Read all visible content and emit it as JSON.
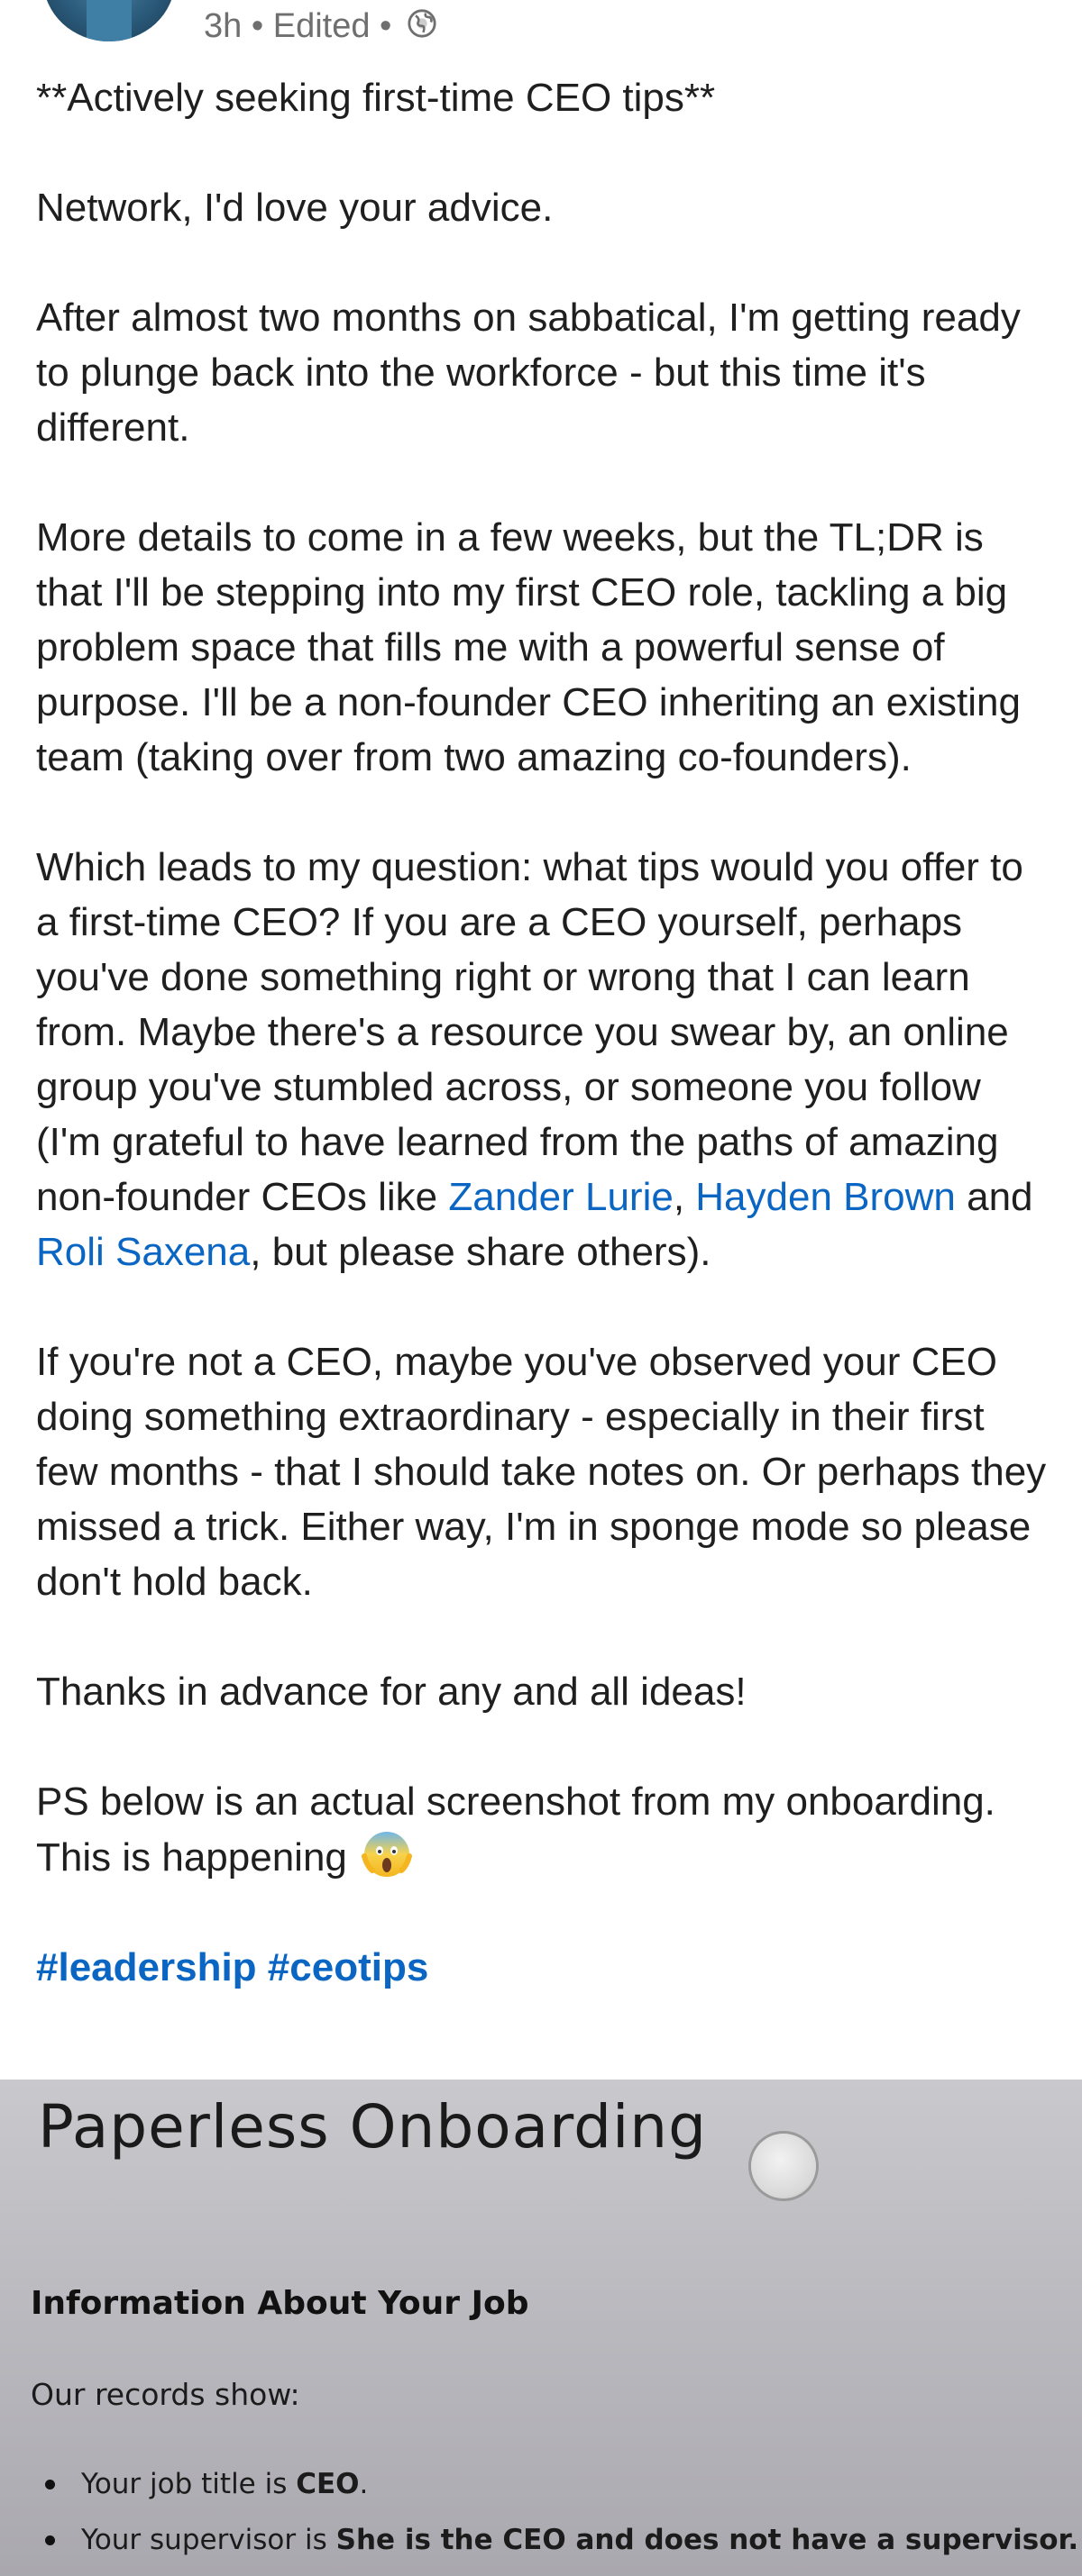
{
  "meta": {
    "time_ago": "3h",
    "separator": "•",
    "edited_label": "Edited",
    "visibility_icon": "globe-icon"
  },
  "post": {
    "paragraphs": [
      "**Actively seeking first-time CEO tips**",
      "Network, I'd love your advice.",
      "After almost two months on sabbatical, I'm getting ready to plunge back into the workforce - but this time it's different.",
      "More details to come in a few weeks, but the TL;DR is that I'll be stepping into my first CEO role, tackling a big problem space that fills me with a powerful sense of purpose. I'll be a non-founder CEO inheriting an existing team (taking over from two amazing co-founders)."
    ],
    "question": {
      "text_before": "Which leads to my question: what tips would you offer to a first-time CEO? If you are a CEO yourself, perhaps you've done something right or wrong that I can learn from. Maybe there's a resource you swear by, an online group you've stumbled across, or someone you follow (I'm grateful to have learned from the paths of amazing non-founder CEOs like ",
      "mention_1": "Zander Lurie",
      "sep_1": ", ",
      "mention_2": "Hayden Brown",
      "sep_2": " and ",
      "mention_3": "Roli Saxena",
      "text_after": ", but please share others)."
    },
    "non_ceo_paragraph": "If you're not a CEO, maybe you've observed your CEO doing something extraordinary - especially in their first few months - that I should take notes on. Or perhaps they missed a trick. Either way, I'm in sponge mode so please don't hold back.",
    "thanks_paragraph": "Thanks in advance for any and all ideas!",
    "ps_paragraph": "PS below is an actual screenshot from my onboarding. This is happening",
    "ps_emoji": "screaming-face-emoji",
    "hashtags": [
      "#leadership",
      "#ceotips"
    ]
  },
  "attached_image": {
    "title": "Paperless Onboarding",
    "heading": "Information About Your Job",
    "records_label": "Our records show:",
    "items": [
      {
        "prefix": "Your job title is ",
        "value": "CEO",
        "suffix": "."
      },
      {
        "prefix": "Your supervisor is ",
        "value": "She is the CEO and does not have a supervisor",
        "suffix": "."
      }
    ]
  },
  "colors": {
    "link": "#0a66c2",
    "meta_text": "#6f6f6f",
    "body_text": "#1f1f1f"
  }
}
